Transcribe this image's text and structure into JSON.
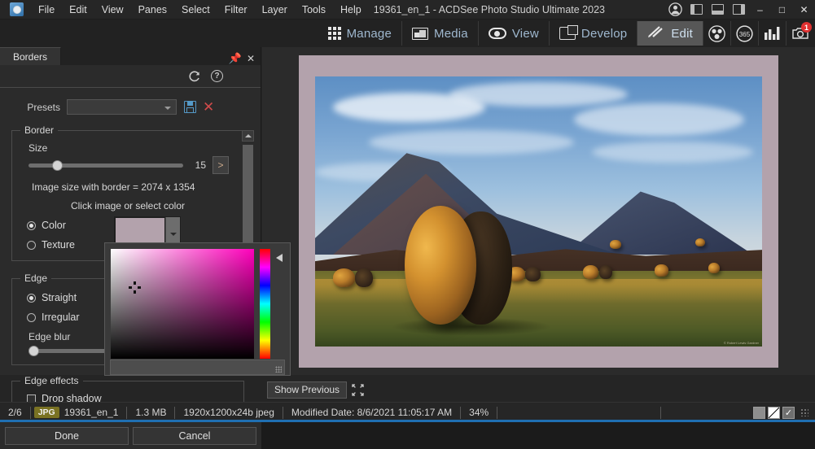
{
  "window": {
    "title": "19361_en_1 - ACDSee Photo Studio Ultimate 2023",
    "menu": [
      "File",
      "Edit",
      "View",
      "Panes",
      "Select",
      "Filter",
      "Layer",
      "Tools",
      "Help"
    ],
    "account_icon": "person-icon",
    "layout_icons": [
      "left-panel-icon",
      "bottom-panel-icon",
      "right-panel-icon"
    ],
    "controls": {
      "minimize": "–",
      "maximize": "□",
      "close": "✕"
    }
  },
  "modebar": {
    "tabs": [
      {
        "label": "Manage",
        "icon": "grid-icon",
        "active": false
      },
      {
        "label": "Media",
        "icon": "media-icon",
        "active": false
      },
      {
        "label": "View",
        "icon": "eye-icon",
        "active": false
      },
      {
        "label": "Develop",
        "icon": "develop-icon",
        "active": false
      },
      {
        "label": "Edit",
        "icon": "edit-brush-icon",
        "active": true
      }
    ],
    "icon_buttons": [
      {
        "name": "people-icon",
        "badge": ""
      },
      {
        "name": "365-icon",
        "label": "365",
        "badge": ""
      },
      {
        "name": "chart-icon",
        "badge": ""
      },
      {
        "name": "camera-icon",
        "badge": "1"
      }
    ]
  },
  "panel": {
    "tab_label": "Borders",
    "pin_icon": "pin-icon",
    "close_icon": "close-icon",
    "reset_icon": "reset-icon",
    "help_icon": "help-icon",
    "presets": {
      "label": "Presets",
      "value": "",
      "placeholder": "",
      "save_icon": "save-icon",
      "delete_icon": "delete-icon"
    },
    "border_group": {
      "legend": "Border",
      "size_label": "Size",
      "size_value": "15",
      "size_percent": 19,
      "expand_label": ">",
      "image_size_text": "Image size with border  =  2074 x 1354",
      "click_hint": "Click image or select color",
      "fill_options": [
        {
          "label": "Color",
          "selected": true
        },
        {
          "label": "Texture",
          "selected": false
        }
      ],
      "swatch_color": "#b3a2ac"
    },
    "edge_group": {
      "legend": "Edge",
      "options": [
        {
          "label": "Straight",
          "selected": true
        },
        {
          "label": "Irregular",
          "selected": false
        }
      ],
      "blur_label": "Edge blur",
      "blur_value": "0",
      "blur_percent": 2
    },
    "edge_effects_group": {
      "legend": "Edge effects",
      "drop_shadow_label": "Drop shadow",
      "drop_shadow_checked": false
    },
    "color_picker": {
      "hue_color": "#ff00bb",
      "selector_icon": "crosshair-icon",
      "hue_arrow_icon": "hue-pointer-icon"
    },
    "buttons": {
      "done": "Done",
      "cancel": "Cancel"
    }
  },
  "viewer": {
    "show_previous_label": "Show Previous",
    "fullscreen_icon": "expand-icon",
    "border_color": "#b3a2ac",
    "photo_watermark": "© Robert Lewis Gardner"
  },
  "statusbar": {
    "position": "2/6",
    "format": "JPG",
    "filename": "19361_en_1",
    "filesize": "1.3 MB",
    "dimensions": "1920x1200x24b jpeg",
    "modified": "Modified Date: 8/6/2021 11:05:17 AM",
    "zoom": "34%",
    "right_icons": [
      "solid-square-icon",
      "split-square-icon",
      "checkmark-icon"
    ]
  }
}
